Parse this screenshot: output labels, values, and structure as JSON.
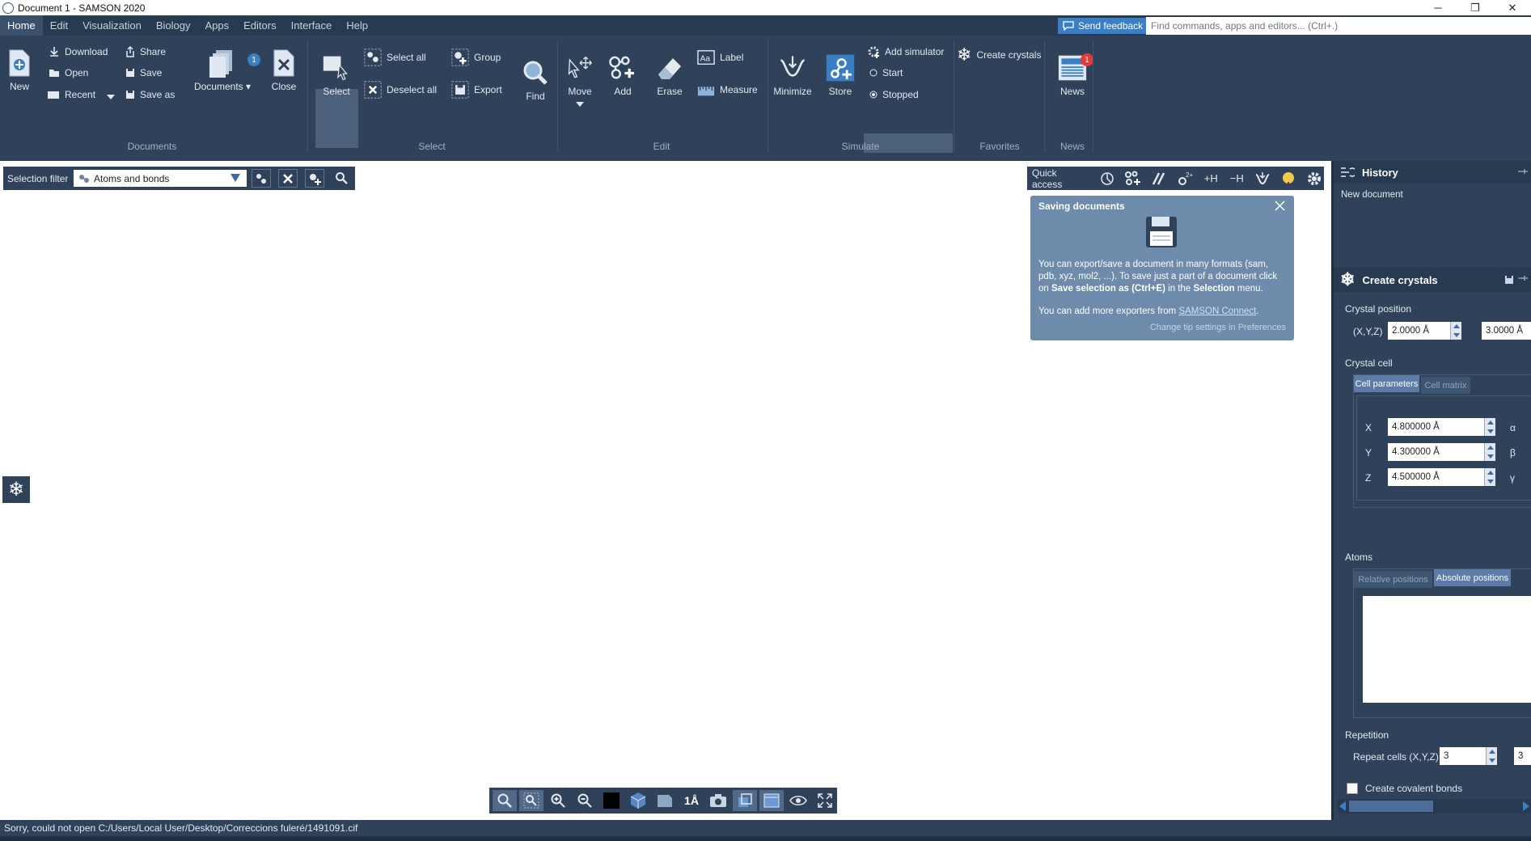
{
  "window": {
    "title": "Document 1 - SAMSON 2020",
    "controls": {
      "minimize": "─",
      "maximize": "❐",
      "close": "✕"
    }
  },
  "menu": {
    "items": [
      "Home",
      "Edit",
      "Visualization",
      "Biology",
      "Apps",
      "Editors",
      "Interface",
      "Help"
    ],
    "feedback_label": "Send feedback",
    "search_placeholder": "Find commands, apps and editors... (Ctrl+.)"
  },
  "ribbon": {
    "documents": {
      "group_label": "Documents",
      "new": "New",
      "download": "Download",
      "open": "Open",
      "recent": "Recent",
      "share": "Share",
      "save": "Save",
      "save_as": "Save as",
      "documents": "Documents",
      "documents_badge": "1",
      "close": "Close"
    },
    "select": {
      "group_label": "Select",
      "select": "Select",
      "select_all": "Select all",
      "deselect_all": "Deselect all",
      "group": "Group",
      "export": "Export",
      "find": "Find"
    },
    "edit": {
      "group_label": "Edit",
      "move": "Move",
      "add": "Add",
      "erase": "Erase",
      "label": "Label",
      "measure": "Measure"
    },
    "simulate": {
      "group_label": "Simulate",
      "minimize": "Minimize",
      "store": "Store",
      "add_simulator": "Add simulator",
      "start": "Start",
      "stopped": "Stopped"
    },
    "favorites": {
      "group_label": "Favorites",
      "create_crystals": "Create crystals"
    },
    "news": {
      "group_label": "News",
      "news": "News",
      "badge": "1"
    }
  },
  "selection_filter": {
    "label": "Selection filter",
    "value": "Atoms and bonds"
  },
  "quick_access": {
    "label": "Quick access",
    "add_h": "+H",
    "remove_h": "−H"
  },
  "tip": {
    "title": "Saving documents",
    "body_part1": "You can export/save a document in many formats (sam, pdb, xyz, mol2, ...). To save just a part of a document click on ",
    "body_bold1": "Save selection as (Ctrl+E)",
    "body_part2": " in the ",
    "body_bold2": "Selection",
    "body_part3": " menu.",
    "more_prefix": "You can add more exporters from ",
    "more_link": "SAMSON Connect",
    "more_suffix": ".",
    "preferences": "Change tip settings in Preferences"
  },
  "history_panel": {
    "title": "History",
    "entries": [
      "New document"
    ]
  },
  "crystals_panel": {
    "title": "Create crystals",
    "crystal_position_label": "Crystal position",
    "xyz_label": "(X,Y,Z)",
    "position_x": "2.0000 Å",
    "position_y": "3.0000 Å",
    "crystal_cell_label": "Crystal cell",
    "tab_cell_parameters": "Cell parameters",
    "tab_cell_matrix": "Cell matrix",
    "cell": [
      {
        "axis": "X",
        "value": "4.800000 Å",
        "angle": "α"
      },
      {
        "axis": "Y",
        "value": "4.300000 Å",
        "angle": "β"
      },
      {
        "axis": "Z",
        "value": "4.500000 Å",
        "angle": "γ"
      }
    ],
    "atoms_label": "Atoms",
    "tab_relative": "Relative positions",
    "tab_absolute": "Absolute positions",
    "repetition_label": "Repetition",
    "repeat_label": "Repeat cells (X,Y,Z)",
    "repeat_x": "3",
    "repeat_y": "3",
    "covalent_label": "Create covalent bonds"
  },
  "status": {
    "message": "Sorry, could not open C:/Users/Local User/Desktop/Correccions fuleré/1491091.cif"
  },
  "colors": {
    "ribbon_bg": "#2f4259",
    "menubar_bg": "#283a4f",
    "accent": "#3a7fc6",
    "badge": "#e53935",
    "tip_bg": "#6e8bab"
  }
}
